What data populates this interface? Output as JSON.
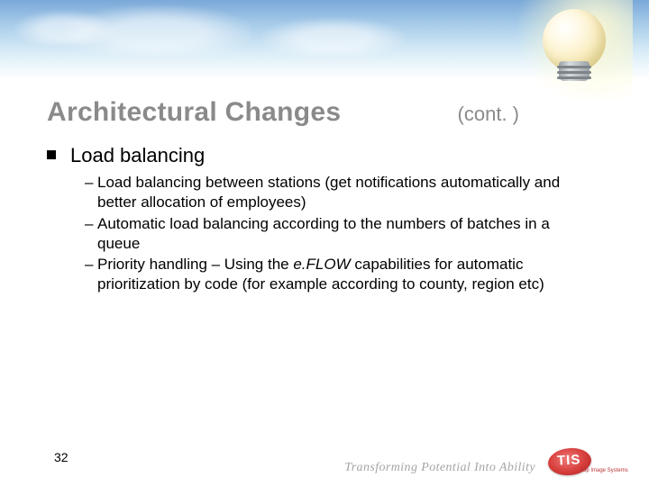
{
  "header": {
    "title": "Architectural Changes",
    "continuation": "(cont. )"
  },
  "content": {
    "main_bullet": "Load balancing",
    "sub_bullets": [
      "Load balancing between stations (get notifications automatically and better allocation of employees)",
      "Automatic load balancing according to the numbers of batches in a queue",
      {
        "prefix": "Priority handling – Using the ",
        "em": "e.FLOW",
        "suffix": " capabilities for automatic prioritization by code (for example according to county, region etc)"
      }
    ]
  },
  "footer": {
    "page_number": "32",
    "tagline": "Transforming Potential Into Ability",
    "logo_text": "TIS",
    "logo_sub": "Top Image Systems"
  },
  "colors": {
    "title_gray": "#8a8a8a",
    "logo_red": "#d63d3b"
  }
}
